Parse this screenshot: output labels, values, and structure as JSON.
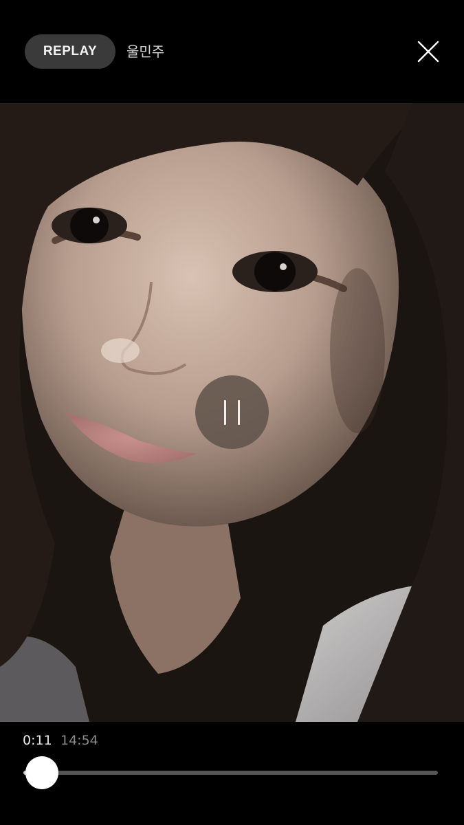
{
  "header": {
    "badge_label": "REPLAY",
    "channel_name": "울민주",
    "close_icon": "close-icon"
  },
  "player": {
    "state": "playing",
    "pause_icon": "pause-icon",
    "video_content": "selfie-video-frame"
  },
  "playback": {
    "current_time": "0:11",
    "total_time": "14:54",
    "progress_fraction": 0.0123
  },
  "colors": {
    "background": "#000000",
    "badge_bg": "#3a3a3a",
    "track": "#555555",
    "thumb": "#ffffff"
  }
}
